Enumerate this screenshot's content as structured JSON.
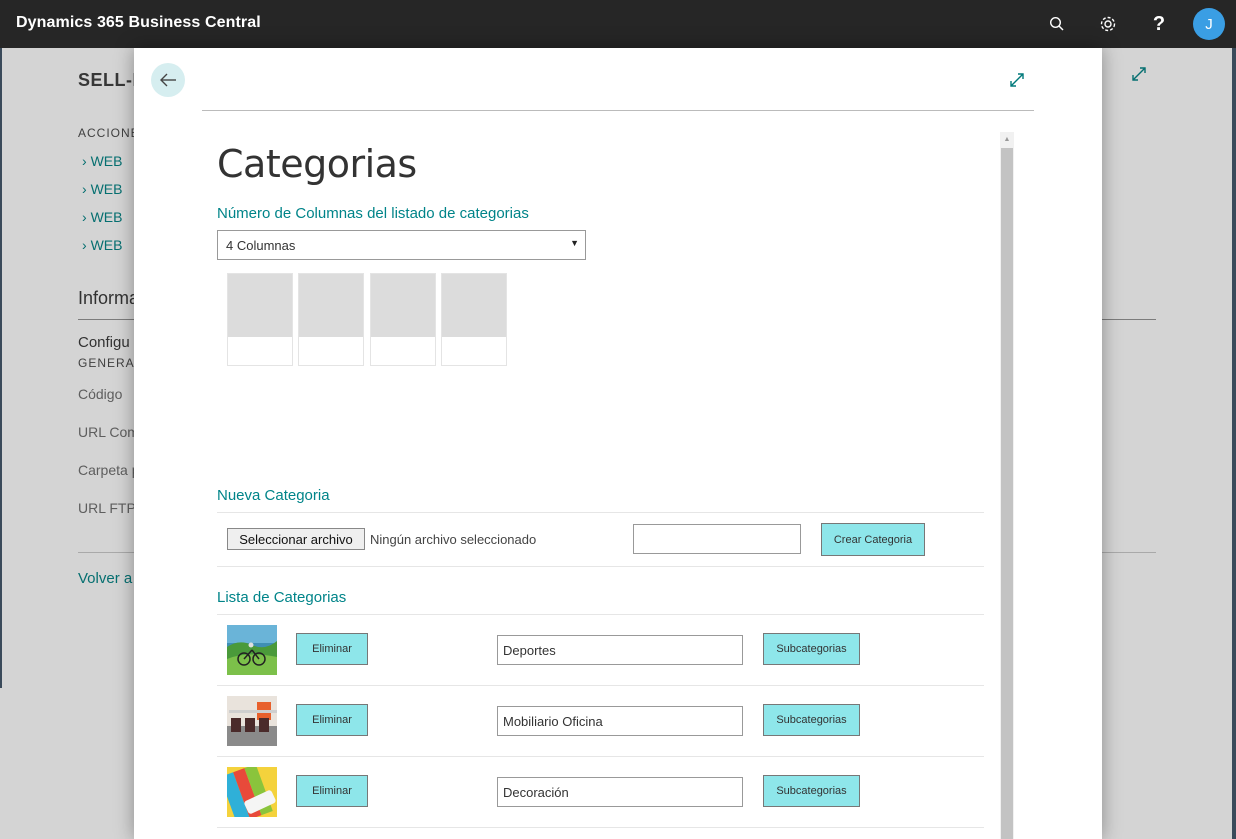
{
  "app": {
    "title": "Dynamics 365 Business Central",
    "avatar_initial": "J"
  },
  "background_page": {
    "title": "SELL-IT",
    "actions_header": "ACCIONES",
    "links": [
      "WEB",
      "WEB",
      "WEB",
      "WEB"
    ],
    "info_heading": "Informa",
    "config_label": "Configu",
    "general_label": "GENERAL",
    "fields": [
      "Código",
      "URL Com",
      "Carpeta p",
      "URL FTP"
    ],
    "back_link": "Volver a"
  },
  "dialog": {
    "heading": "Categorias",
    "columns_label": "Número de Columnas del listado de categorias",
    "columns_selected": "4 Columnas",
    "preview_tile_count": 4,
    "new_category": {
      "heading": "Nueva Categoria",
      "file_button": "Seleccionar archivo",
      "file_status": "Ningún archivo seleccionado",
      "name_value": "",
      "create_button": "Crear Categoria"
    },
    "list": {
      "heading": "Lista de Categorias",
      "delete_label": "Eliminar",
      "subcategories_label": "Subcategorias",
      "items": [
        {
          "name": "Deportes",
          "thumbnail": "cyclists-photo"
        },
        {
          "name": "Mobiliario Oficina",
          "thumbnail": "office-furniture-photo"
        },
        {
          "name": "Decoración",
          "thumbnail": "paint-swatches-photo"
        }
      ]
    }
  },
  "colors": {
    "accent": "#008489",
    "button": "#8ee6ea",
    "topbar": "#262626",
    "avatar": "#3a9ee4"
  }
}
